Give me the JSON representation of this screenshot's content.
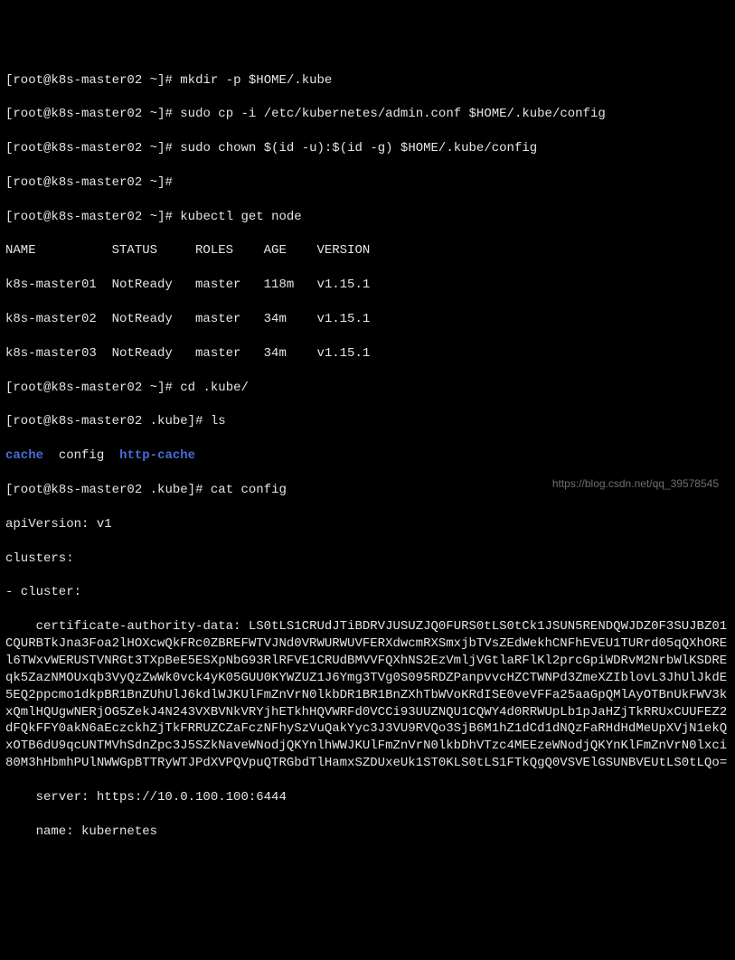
{
  "prompt_host": "k8s-master02",
  "prompt_home_dir": "~",
  "prompt_kube_dir": ".kube",
  "cmds": {
    "mkdir": "mkdir -p $HOME/.kube",
    "cp": "sudo cp -i /etc/kubernetes/admin.conf $HOME/.kube/config",
    "chown": "sudo chown $(id -u):$(id -g) $HOME/.kube/config",
    "empty": "",
    "get_node": "kubectl get node",
    "cd": "cd .kube/",
    "ls": "ls",
    "cat": "cat config"
  },
  "node_table": {
    "header": "NAME          STATUS     ROLES    AGE    VERSION",
    "rows": [
      "k8s-master01  NotReady   master   118m   v1.15.1",
      "k8s-master02  NotReady   master   34m    v1.15.1",
      "k8s-master03  NotReady   master   34m    v1.15.1"
    ]
  },
  "ls_output": {
    "cache": "cache",
    "config": "config",
    "http_cache": "http-cache"
  },
  "config": {
    "apiVersion": "apiVersion: v1",
    "clusters": "clusters:",
    "cluster_item": "- cluster:",
    "cert_key_indent": "    certificate-authority-data: ",
    "cert_data": "LS0tLS1CRUdJTiBDRVJUSUZJQ0FURS0tLS0tCk1JSUN5RENDQWJDZ0F3SUJBZ01CQURBTkJna3Foa2lHOXcwQkFRc0ZBREFWTVJNd0VRWURWUVFERXdwcmRXSmxjbTVsZEdWekhCNFhEVEU1TURrd05qQXhOREl6TWxvWERUSTVNRGt3TXpBeE5ESXpNbG93RlRFVE1CRUdBMVVFQXhNS2EzVmljVGtlaRFlKl2prcGpiWDRvM2NrbWlKSDREqk5ZazNMOUxqb3VyQzZwWk0vck4yK05GUU0KYWZUZ1J6Ymg3TVg0S095RDZPanpvvcHZCTWNPd3ZmeXZIblovL3JhUlJkdE5EQ2ppcmo1dkpBR1BnZUhUlJ6kdlWJKUlFmZnVrN0lkbDR1BR1BnZXhTbWVoKRdISE0veVFFa25aaGpQMlAyOTBnUkFWV3kxQmlHQUgwNERjOG5ZekJ4N243VXBVNkVRYjhETkhHQVWRFd0VCCi93UUZNQU1CQWY4d0RRWUpLb1pJaHZjTkRRUxCUUFEZ2dFQkFFY0akN6aEczckhZjTkFRRUZCZaFczNFhySzVuQakYyc3J3VU9RVQo3SjB6M1hZ1dCd1dNQzFaRHdHdMeUpXVjN1ekQxOTB6dU9qcUNTMVhSdnZpc3J5SZkNaveWNodjQKYnlhWWJKUlFmZnVrN0lkbDhVTzc4MEEzeWNodjQKYnKlFmZnVrN0lxci80M3hHbmhPUlNWWGpBTTRyWTJPdXVPQVpuQTRGbdTlHamxSZDUxeUk1ST0KLS0tLS1FTkQgQ0VSVElGSUNBVEUtLS0tLQo=",
    "server": "    server: https://10.0.100.100:6444",
    "name": "    name: kubernetes"
  },
  "watermark": "https://blog.csdn.net/qq_39578545"
}
